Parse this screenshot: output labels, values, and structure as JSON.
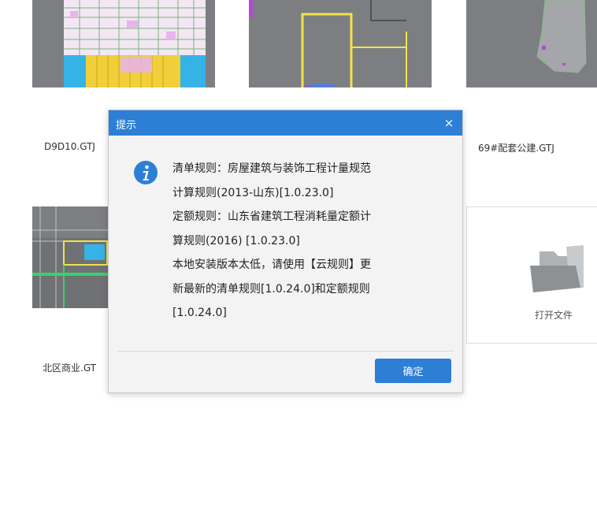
{
  "files": [
    {
      "name": "D9D10.GTJ"
    },
    {
      "name": ""
    },
    {
      "name": "69#配套公建.GTJ"
    },
    {
      "name": "北区商业.GT"
    }
  ],
  "open_file": {
    "label": "打开文件",
    "icon": "folder-icon"
  },
  "dialog": {
    "title": "提示",
    "close_label": "×",
    "icon": "info-icon",
    "lines": [
      "清单规则：房屋建筑与装饰工程计量规范",
      "计算规则(2013-山东)[1.0.23.0]",
      "定额规则：山东省建筑工程消耗量定额计",
      "算规则(2016) [1.0.23.0]",
      "本地安装版本太低，请使用【云规则】更",
      "新最新的清单规则[1.0.24.0]和定额规则",
      "[1.0.24.0]"
    ],
    "ok_label": "确定"
  },
  "colors": {
    "accent": "#2d7fd6",
    "thumbnail_bg": "#7c7e82"
  }
}
